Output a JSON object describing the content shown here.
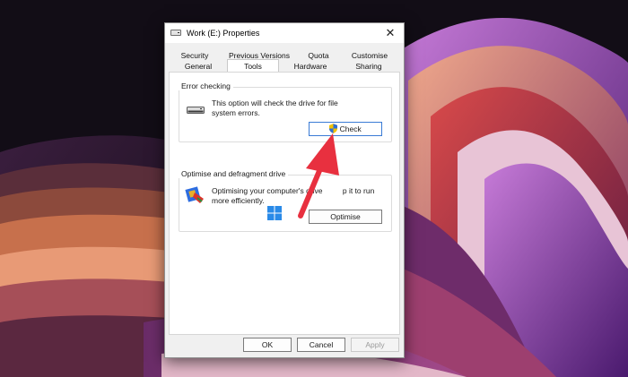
{
  "window": {
    "title": "Work (E:) Properties",
    "close_glyph": "✕"
  },
  "tabs": {
    "row1": [
      "Security",
      "Previous Versions",
      "Quota",
      "Customise"
    ],
    "row2": [
      "General",
      "Tools",
      "Hardware",
      "Sharing"
    ],
    "active": "Tools"
  },
  "error_checking": {
    "label": "Error checking",
    "description": "This option will check the drive for file system errors.",
    "button": "Check"
  },
  "optimise": {
    "label": "Optimise and defragment drive",
    "description_line1": "Optimising your computer's drive",
    "description_tail": "p it to run",
    "description_line2": "more efficiently.",
    "button": "Optimise"
  },
  "footer": {
    "ok": "OK",
    "cancel": "Cancel",
    "apply": "Apply"
  },
  "colors": {
    "arrow": "#e8303f",
    "accent": "#3a7bd5"
  },
  "icons": [
    "drive-icon",
    "uac-shield-icon",
    "defrag-icon",
    "windows-logo-icon",
    "close-icon"
  ]
}
